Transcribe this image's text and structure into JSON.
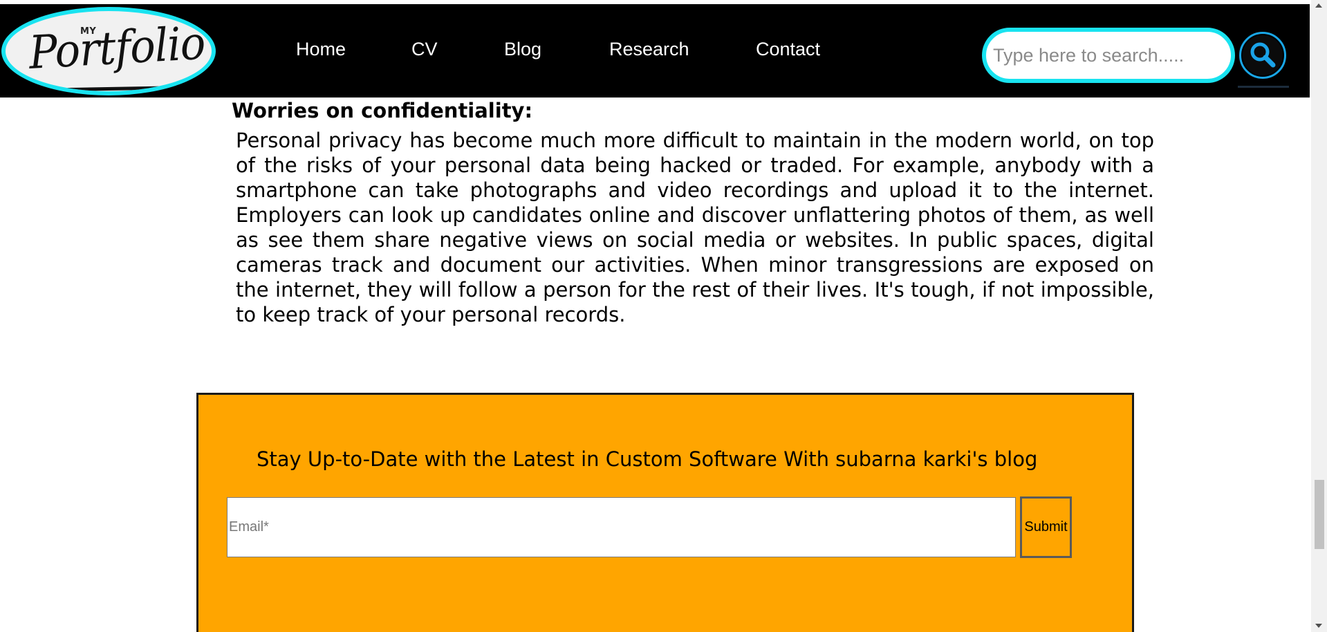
{
  "logo": {
    "small_text": "MY",
    "word": "Portfolio"
  },
  "nav": {
    "items": [
      {
        "label": "Home"
      },
      {
        "label": "CV"
      },
      {
        "label": "Blog"
      },
      {
        "label": "Research"
      },
      {
        "label": "Contact"
      }
    ]
  },
  "search": {
    "placeholder": "Type here to search.....",
    "icon": "search-icon"
  },
  "article": {
    "heading": "Worries on confidentiality:",
    "body": "Personal privacy has become much more difficult to maintain in the modern world, on top of the risks of your personal data being hacked or traded. For example, anybody with a smartphone can take photographs and video recordings and upload it to the internet. Employers can look up candidates online and discover unflattering photos of them, as well as see them share negative views on social media or websites. In public spaces, digital cameras track and document our activities. When minor transgressions are exposed on the internet, they will follow a person for the rest of their lives. It's tough, if not impossible, to keep track of your personal records."
  },
  "subscribe": {
    "title": "Stay Up-to-Date with the Latest in Custom Software With subarna karki's blog",
    "email_placeholder": "Email*",
    "email_value": "",
    "submit_label": "Submit"
  },
  "colors": {
    "header_bg": "#000000",
    "accent_cyan": "#19e3f0",
    "subscribe_bg": "#ffa500",
    "search_ring": "#19a6e6"
  }
}
